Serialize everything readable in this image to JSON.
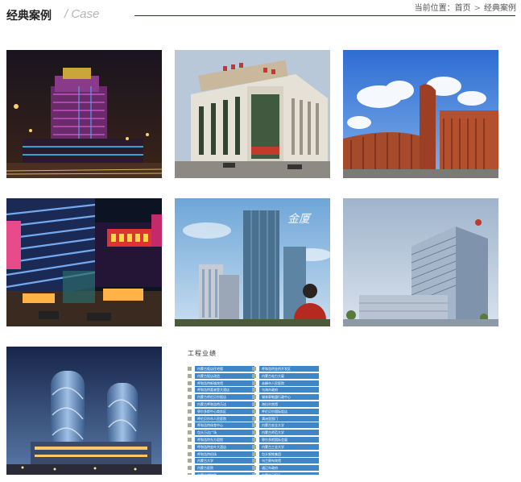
{
  "header": {
    "title_cn": "经典案例",
    "title_sep": "/",
    "title_en": "Case",
    "breadcrumb": {
      "prefix": "当前位置：",
      "home": "首页",
      "separator": ">",
      "current": "经典案例"
    }
  },
  "cases": [
    {
      "name": "night-hotel-photo"
    },
    {
      "name": "office-building-photo"
    },
    {
      "name": "red-curved-building-photo"
    },
    {
      "name": "neon-mall-photo"
    },
    {
      "name": "jinsha-plaza-photo"
    },
    {
      "name": "hospital-rendering-photo"
    },
    {
      "name": "twin-towers-rendering-photo"
    },
    {
      "name": "project-list-image"
    }
  ],
  "project_list": {
    "title": "工程业绩",
    "col1": [
      "内蒙古饭店住宅楼",
      "内蒙古饭店改造",
      "呼和浩特新城宾馆",
      "呼和浩特喜来登大酒店",
      "内蒙古呼伦贝尔饭店",
      "内蒙古呼和浩特万达",
      "鄂尔多斯中心商务区",
      "呼伦贝尔市人民医院",
      "呼和浩特体育中心",
      "包头万达广场",
      "呼和浩特东方君悦",
      "呼和浩特金叶大酒店",
      "呼和浩特机场",
      "内蒙古大学",
      "内蒙古医院",
      "内蒙古博物院"
    ],
    "col2": [
      "呼和浩特金桥开发区",
      "内蒙古电力大厦",
      "赤峰市人民医院",
      "乌海市政府",
      "锡林郭勒盟行政中心",
      "海拉尔宾馆",
      "呼伦贝尔国际饭店",
      "满洲里国门",
      "内蒙古农业大学",
      "内蒙古师范大学",
      "鄂尔多斯国际会展",
      "内蒙古工业大学",
      "包头钢铁集团",
      "乌兰察布宾馆",
      "通辽市政府",
      "内蒙古日报社"
    ],
    "colors": {
      "item": "#3f86c6",
      "bullet": "#a6ad90"
    }
  }
}
